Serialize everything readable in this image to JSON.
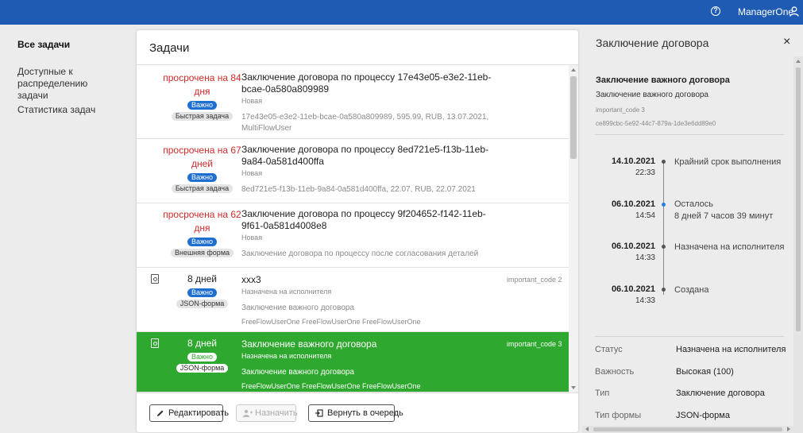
{
  "header": {
    "help_icon": "?",
    "user_name": "ManagerOne",
    "user_icon": "user-icon",
    "bg_color": "#1f5bb3"
  },
  "nav": {
    "items": [
      {
        "label": "Все задачи",
        "active": true
      },
      {
        "label": "Доступные к распределению задачи",
        "active": false
      },
      {
        "label": "Статистика задач",
        "active": false
      }
    ]
  },
  "tasks": {
    "title": "Задачи",
    "rows": [
      {
        "deadline": "просрочена на 84 дня",
        "importance": "Важно",
        "form_type": "Быстрая задача",
        "title": "Заключение договора по процессу 17e43e05-e3e2-11eb-bcae-0a580a809989",
        "status": "Новая",
        "description": "17e43e05-e3e2-11eb-bcae-0a580a809989, 595.99, RUB, 13.07.2021, MultiFlowUser",
        "code": ""
      },
      {
        "deadline": "просрочена на 67 дней",
        "importance": "Важно",
        "form_type": "Быстрая задача",
        "title": "Заключение договора по процессу 8ed721e5-f13b-11eb-9a84-0a581d400ffa",
        "status": "Новая",
        "description": "8ed721e5-f13b-11eb-9a84-0a581d400ffa, 22.07, RUB, 22.07.2021",
        "code": ""
      },
      {
        "deadline": "просрочена на 62 дня",
        "importance": "Важно",
        "form_type": "Внешняя форма",
        "title": "Заключение договора по процессу 9f204652-f142-11eb-9f61-0a581d4008e8",
        "status": "Новая",
        "description": "Заключение договора по процессу после согласования деталей",
        "code": ""
      },
      {
        "deadline": "8 дней",
        "importance": "Важно",
        "form_type": "JSON-форма",
        "title": "xxx3",
        "status": "Назначена на исполнителя",
        "description": "Заключение важного договора",
        "description2": "FreeFlowUserOne FreeFlowUserOne FreeFlowUserOne",
        "code": "important_code 2"
      },
      {
        "deadline": "8 дней",
        "importance": "Важно",
        "form_type": "JSON-форма",
        "title": "Заключение важного договора",
        "status": "Назначена на исполнителя",
        "description": "Заключение важного договора",
        "description2": "FreeFlowUserOne FreeFlowUserOne FreeFlowUserOne",
        "code": "important_code 3",
        "selected": true
      }
    ],
    "buttons": {
      "edit": "Редактировать",
      "assign": "Назначить",
      "return": "Вернуть в очередь"
    }
  },
  "details": {
    "title": "Заключение договора",
    "close_icon": "×",
    "heading": "Заключение важного договора",
    "subtitle": "Заключение важного договора",
    "code": "important_code 3",
    "id": "ce899cbc-5e92-44c7-879a-1de3e6dd89e0",
    "timeline": [
      {
        "date": "14.10.2021",
        "time": "22:33",
        "label": "Крайний срок выполнения",
        "label2": ""
      },
      {
        "date": "06.10.2021",
        "time": "14:54",
        "label": "Осталось",
        "label2": "8 дней 7 часов 39 минут",
        "current": true
      },
      {
        "date": "06.10.2021",
        "time": "14:33",
        "label": "Назначена на исполнителя",
        "label2": ""
      },
      {
        "date": "06.10.2021",
        "time": "14:33",
        "label": "Создана",
        "label2": ""
      }
    ],
    "fields": [
      {
        "key": "Статус",
        "value": "Назначена на исполнителя"
      },
      {
        "key": "Важность",
        "value": "Высокая (100)"
      },
      {
        "key": "Тип",
        "value": "Заключение договора"
      },
      {
        "key": "Тип формы",
        "value": "JSON-форма"
      }
    ]
  },
  "colors": {
    "selected_row": "#2ea82e",
    "overdue": "#d12a2a",
    "importance_badge": "#1f6fd1"
  }
}
